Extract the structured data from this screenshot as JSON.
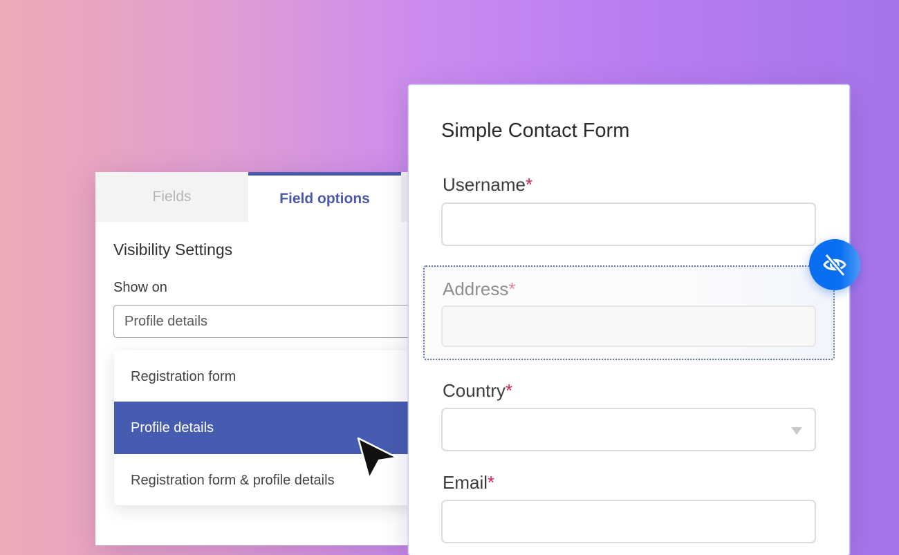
{
  "settings_panel": {
    "tabs": [
      {
        "label": "Fields",
        "active": false
      },
      {
        "label": "Field options",
        "active": true
      }
    ],
    "section_title": "Visibility Settings",
    "show_on_label": "Show on",
    "show_on_value": "Profile details",
    "dropdown_options": [
      {
        "label": "Registration form",
        "selected": false
      },
      {
        "label": "Profile details",
        "selected": true
      },
      {
        "label": "Registration form & profile details",
        "selected": false
      }
    ]
  },
  "form": {
    "title": "Simple Contact Form",
    "required_marker": "*",
    "fields": [
      {
        "label": "Username",
        "value": "",
        "type": "text",
        "hidden": false
      },
      {
        "label": "Address",
        "value": "",
        "type": "text",
        "hidden": true
      },
      {
        "label": "Country",
        "value": "",
        "type": "select",
        "hidden": false
      },
      {
        "label": "Email",
        "value": "",
        "type": "text",
        "hidden": false
      }
    ]
  },
  "visibility_toggle": {
    "icon": "eye-off-icon"
  },
  "colors": {
    "accent": "#465cb0",
    "required": "#d0245e",
    "toggle": "#0a6ef0"
  }
}
